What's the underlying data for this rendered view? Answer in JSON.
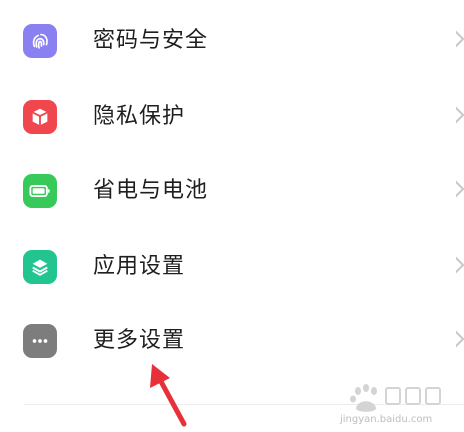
{
  "settings": {
    "items": [
      {
        "label": "密码与安全",
        "icon": "fingerprint-icon",
        "color": "#8b80f2"
      },
      {
        "label": "隐私保护",
        "icon": "privacy-shield-icon",
        "color": "#f0474f"
      },
      {
        "label": "省电与电池",
        "icon": "battery-icon",
        "color": "#37c95a"
      },
      {
        "label": "应用设置",
        "icon": "app-layers-icon",
        "color": "#22c58f"
      },
      {
        "label": "更多设置",
        "icon": "more-dots-icon",
        "color": "#7d7d7d"
      }
    ]
  },
  "annotation": {
    "arrow_color": "#e8303a"
  },
  "watermark": {
    "url": "jingyan.baidu.com"
  }
}
